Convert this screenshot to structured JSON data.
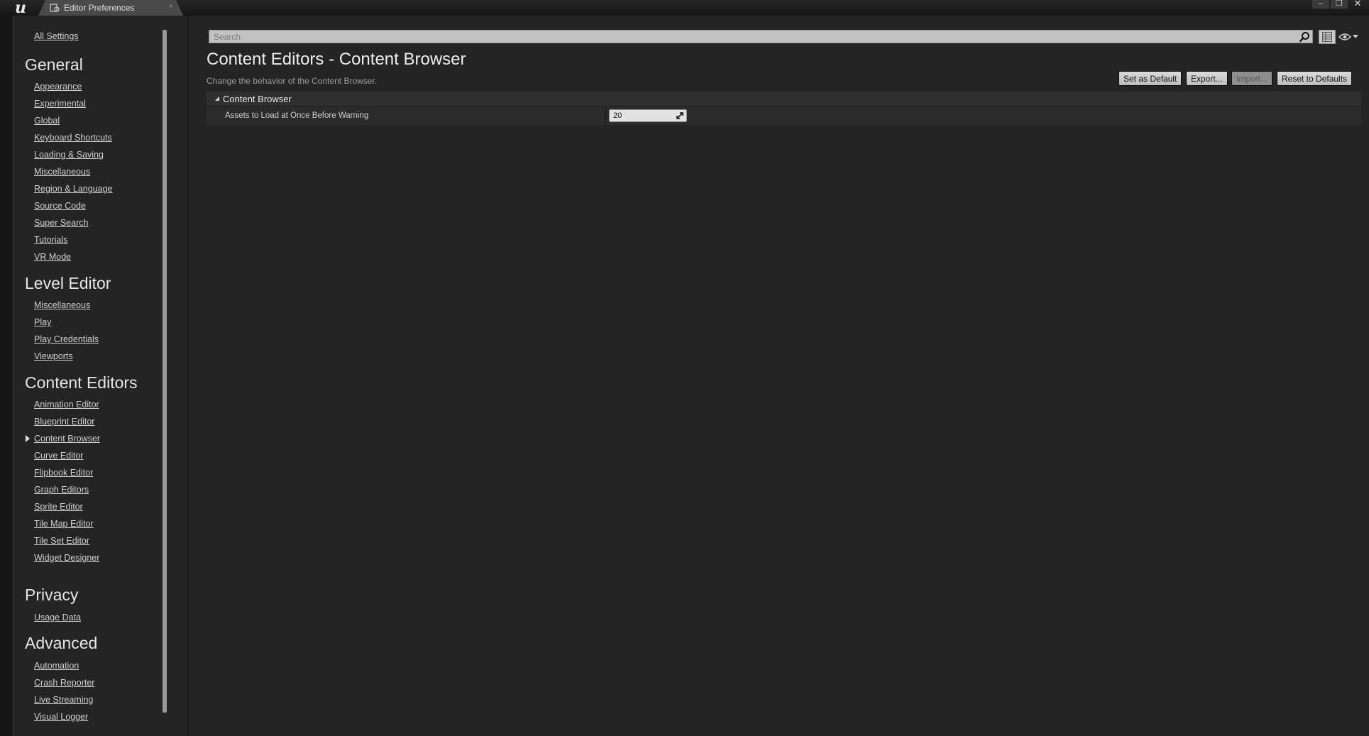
{
  "window": {
    "tab_title": "Editor Preferences",
    "tab_close": "×",
    "controls": {
      "minimize": "–",
      "maximize": "❐",
      "close": "✕"
    }
  },
  "sidebar": {
    "all_settings": "All Settings",
    "sections": [
      {
        "title": "General",
        "items": [
          "Appearance",
          "Experimental",
          "Global",
          "Keyboard Shortcuts",
          "Loading & Saving",
          "Miscellaneous",
          "Region & Language",
          "Source Code",
          "Super Search",
          "Tutorials",
          "VR Mode"
        ]
      },
      {
        "title": "Level Editor",
        "items": [
          "Miscellaneous",
          "Play",
          "Play Credentials",
          "Viewports"
        ]
      },
      {
        "title": "Content Editors",
        "items": [
          "Animation Editor",
          "Blueprint Editor",
          "Content Browser",
          "Curve Editor",
          "Flipbook Editor",
          "Graph Editors",
          "Sprite Editor",
          "Tile Map Editor",
          "Tile Set Editor",
          "Widget Designer"
        ]
      },
      {
        "title": "Privacy",
        "items": [
          "Usage Data"
        ]
      },
      {
        "title": "Advanced",
        "items": [
          "Automation",
          "Crash Reporter",
          "Live Streaming",
          "Visual Logger"
        ]
      }
    ],
    "selected": "Content Browser"
  },
  "search": {
    "placeholder": "Search",
    "value": ""
  },
  "page": {
    "title": "Content Editors - Content Browser",
    "description": "Change the behavior of the Content Browser."
  },
  "actions": {
    "set_default": "Set as Default",
    "export": "Export...",
    "import": "Import...",
    "reset": "Reset to Defaults"
  },
  "category": {
    "label": "Content Browser",
    "properties": [
      {
        "name": "Assets to Load at Once Before Warning",
        "value": "20"
      }
    ]
  },
  "icons": {
    "logo": "unreal-logo",
    "tab": "editor-preferences-icon",
    "search": "search-icon",
    "table_view": "table-view-icon",
    "visibility": "eye-icon"
  },
  "colors": {
    "background": "#242424",
    "panel_dark": "#151515",
    "category_header": "#2f2f2f",
    "property_row": "#2b2b2b"
  }
}
